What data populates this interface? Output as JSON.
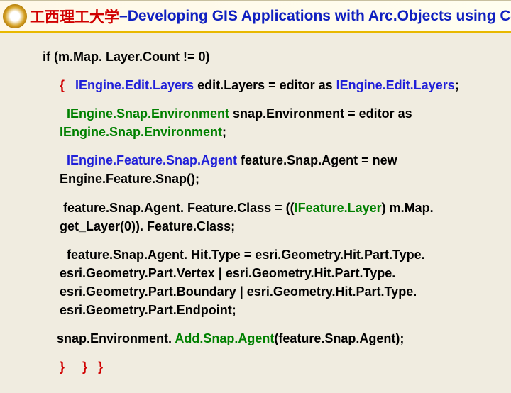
{
  "header": {
    "red_text": "工西理工大学",
    "dash": " – ",
    "blue_text": "Developing GIS Applications with Arc.Objects using C#. NE"
  },
  "code": {
    "l1": "if (m.Map. Layer.Count != 0)",
    "l2_brace": "{",
    "l2_type": "IEngine.Edit.Layers",
    "l2_rest": " edit.Layers = editor as ",
    "l2_type2": "IEngine.Edit.Layers",
    "l2_semi": ";",
    "l3_type": "IEngine.Snap.Environment",
    "l3_rest": " snap.Environment = editor as ",
    "l3_type2": "IEngine.Snap.Environment",
    "l3_semi": ";",
    "l4_type": "IEngine.Feature.Snap.Agent",
    "l4_rest": " feature.Snap.Agent = new ",
    "l4_ctor": "Engine.Feature.Snap",
    "l4_end": "();",
    "l5_a": "feature.Snap.Agent. Feature.Class = ((",
    "l5_type": "IFeature.Layer",
    "l5_b": ") m.Map. get_Layer(0)). Feature.Class;",
    "l6": "feature.Snap.Agent. Hit.Type = esri.Geometry.Hit.Part.Type. esri.Geometry.Part.Vertex | esri.Geometry.Hit.Part.Type. esri.Geometry.Part.Boundary | esri.Geometry.Hit.Part.Type. esri.Geometry.Part.Endpoint;",
    "l7_a": "snap.Environment. ",
    "l7_m": "Add.Snap.Agent",
    "l7_b": "(feature.Snap.Agent);",
    "l8_b1": "}",
    "l8_b2": "}",
    "l8_b3": "}"
  }
}
